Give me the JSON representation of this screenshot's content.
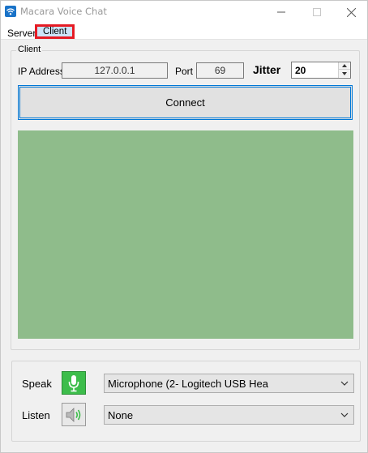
{
  "window": {
    "title": "Macara Voice Chat",
    "accent_color": "#0078d7"
  },
  "menu": {
    "items": [
      {
        "label": "Server"
      },
      {
        "label": "Client"
      }
    ],
    "highlight_color": "#e51b24"
  },
  "client_group": {
    "legend": "Client",
    "ip_label": "IP Address",
    "ip_value": "127.0.0.1",
    "port_label": "Port",
    "port_value": "69",
    "jitter_label": "Jitter",
    "jitter_value": "20",
    "connect_label": "Connect",
    "panel_color": "#8fbc8b"
  },
  "audio": {
    "speak_label": "Speak",
    "speak_icon": "microphone-icon",
    "speak_device": "Microphone (2- Logitech USB Hea",
    "listen_label": "Listen",
    "listen_icon": "speaker-icon",
    "listen_device": "None"
  }
}
